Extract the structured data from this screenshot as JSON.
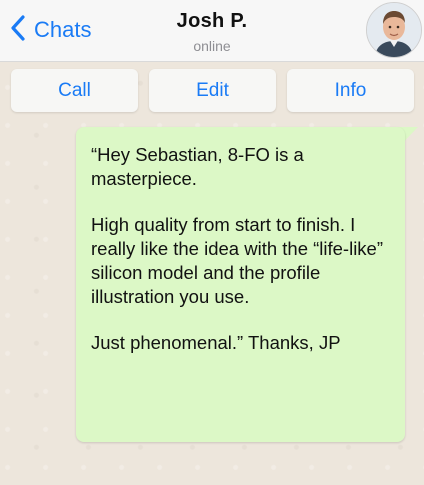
{
  "header": {
    "back_label": "Chats",
    "contact_name": "Josh P.",
    "contact_status": "online"
  },
  "actions": {
    "call_label": "Call",
    "edit_label": "Edit",
    "info_label": "Info"
  },
  "message": {
    "paragraphs": [
      "“Hey Sebastian, 8-FO is a masterpiece.",
      "High quality from start to finish. I really like the idea with the “life-like” silicon model and the profile illustration you use.",
      "Just phenomenal.” Thanks, JP"
    ]
  },
  "icons": {
    "back": "chevron-left-icon",
    "avatar": "avatar-photo"
  },
  "colors": {
    "accent": "#1a7bf5",
    "bubble": "#dcf8c6",
    "background": "#ede6dc",
    "header": "#f7f7f7"
  }
}
